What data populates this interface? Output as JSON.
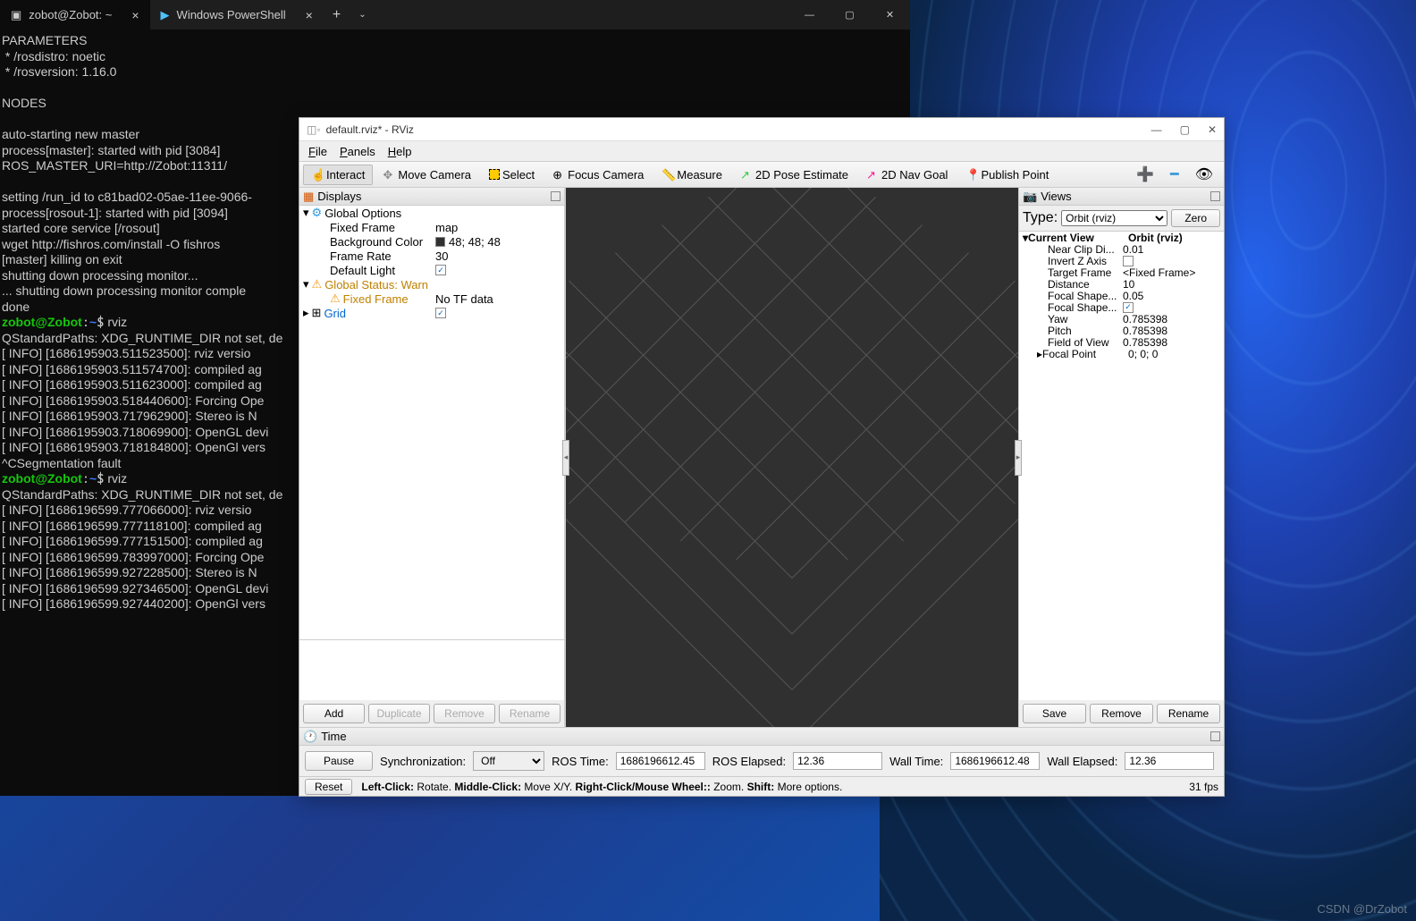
{
  "terminal": {
    "tabs": [
      {
        "icon": "terminal-icon",
        "label": "zobot@Zobot: ~",
        "active": true
      },
      {
        "icon": "powershell-icon",
        "label": "Windows PowerShell",
        "active": false
      }
    ],
    "lines": "PARAMETERS\n * /rosdistro: noetic\n * /rosversion: 1.16.0\n\nNODES\n\nauto-starting new master\nprocess[master]: started with pid [3084]\nROS_MASTER_URI=http://Zobot:11311/\n\nsetting /run_id to c81bad02-05ae-11ee-9066-\nprocess[rosout-1]: started with pid [3094]\nstarted core service [/rosout]\nwget http://fishros.com/install -O fishros\n[master] killing on exit\nshutting down processing monitor...\n... shutting down processing monitor comple\ndone",
    "prompt1_user": "zobot@Zobot",
    "prompt1_path": "~",
    "prompt1_cmd": " rviz",
    "block1": "QStandardPaths: XDG_RUNTIME_DIR not set, de\n[ INFO] [1686195903.511523500]: rviz versio\n[ INFO] [1686195903.511574700]: compiled ag\n[ INFO] [1686195903.511623000]: compiled ag\n[ INFO] [1686195903.518440600]: Forcing Ope\n[ INFO] [1686195903.717962900]: Stereo is N\n[ INFO] [1686195903.718069900]: OpenGL devi\n[ INFO] [1686195903.718184800]: OpenGl vers\n^CSegmentation fault",
    "prompt2_cmd": " rviz",
    "block2": "QStandardPaths: XDG_RUNTIME_DIR not set, de\n[ INFO] [1686196599.777066000]: rviz versio\n[ INFO] [1686196599.777118100]: compiled ag\n[ INFO] [1686196599.777151500]: compiled ag\n[ INFO] [1686196599.783997000]: Forcing Ope\n[ INFO] [1686196599.927228500]: Stereo is N\n[ INFO] [1686196599.927346500]: OpenGL devi\n[ INFO] [1686196599.927440200]: OpenGl vers"
  },
  "rviz": {
    "title": "default.rviz* - RViz",
    "menus": {
      "file": "File",
      "panels": "Panels",
      "help": "Help"
    },
    "toolbar": {
      "interact": "Interact",
      "move_camera": "Move Camera",
      "select": "Select",
      "focus_camera": "Focus Camera",
      "measure": "Measure",
      "pose_estimate": "2D Pose Estimate",
      "nav_goal": "2D Nav Goal",
      "publish_point": "Publish Point"
    },
    "displays": {
      "header": "Displays",
      "global_options": "Global Options",
      "fixed_frame": {
        "label": "Fixed Frame",
        "value": "map"
      },
      "bg_color": {
        "label": "Background Color",
        "value": "48; 48; 48"
      },
      "frame_rate": {
        "label": "Frame Rate",
        "value": "30"
      },
      "default_light": {
        "label": "Default Light",
        "checked": true
      },
      "global_status": "Global Status: Warn",
      "fixed_frame_status": {
        "label": "Fixed Frame",
        "value": "No TF data"
      },
      "grid": {
        "label": "Grid",
        "checked": true
      },
      "buttons": {
        "add": "Add",
        "duplicate": "Duplicate",
        "remove": "Remove",
        "rename": "Rename"
      }
    },
    "views": {
      "header": "Views",
      "type_label": "Type:",
      "type_value": "Orbit (rviz)",
      "zero": "Zero",
      "current_view": {
        "label": "Current View",
        "value": "Orbit (rviz)"
      },
      "props": [
        {
          "label": "Near Clip Di...",
          "value": "0.01"
        },
        {
          "label": "Invert Z Axis",
          "checked": false
        },
        {
          "label": "Target Frame",
          "value": "<Fixed Frame>"
        },
        {
          "label": "Distance",
          "value": "10"
        },
        {
          "label": "Focal Shape...",
          "value": "0.05"
        },
        {
          "label": "Focal Shape...",
          "checked": true
        },
        {
          "label": "Yaw",
          "value": "0.785398"
        },
        {
          "label": "Pitch",
          "value": "0.785398"
        },
        {
          "label": "Field of View",
          "value": "0.785398"
        },
        {
          "label": "Focal Point",
          "value": "0; 0; 0"
        }
      ],
      "buttons": {
        "save": "Save",
        "remove": "Remove",
        "rename": "Rename"
      }
    },
    "time": {
      "header": "Time",
      "pause": "Pause",
      "sync_label": "Synchronization:",
      "sync_value": "Off",
      "ros_time_label": "ROS Time:",
      "ros_time": "1686196612.45",
      "ros_elapsed_label": "ROS Elapsed:",
      "ros_elapsed": "12.36",
      "wall_time_label": "Wall Time:",
      "wall_time": "1686196612.48",
      "wall_elapsed_label": "Wall Elapsed:",
      "wall_elapsed": "12.36"
    },
    "status": {
      "reset": "Reset",
      "hint": "Left-Click: Rotate.  Middle-Click: Move X/Y.  Right-Click/Mouse Wheel:: Zoom.  Shift: More options.",
      "fps": "31 fps"
    }
  },
  "watermark": "CSDN @DrZobot"
}
